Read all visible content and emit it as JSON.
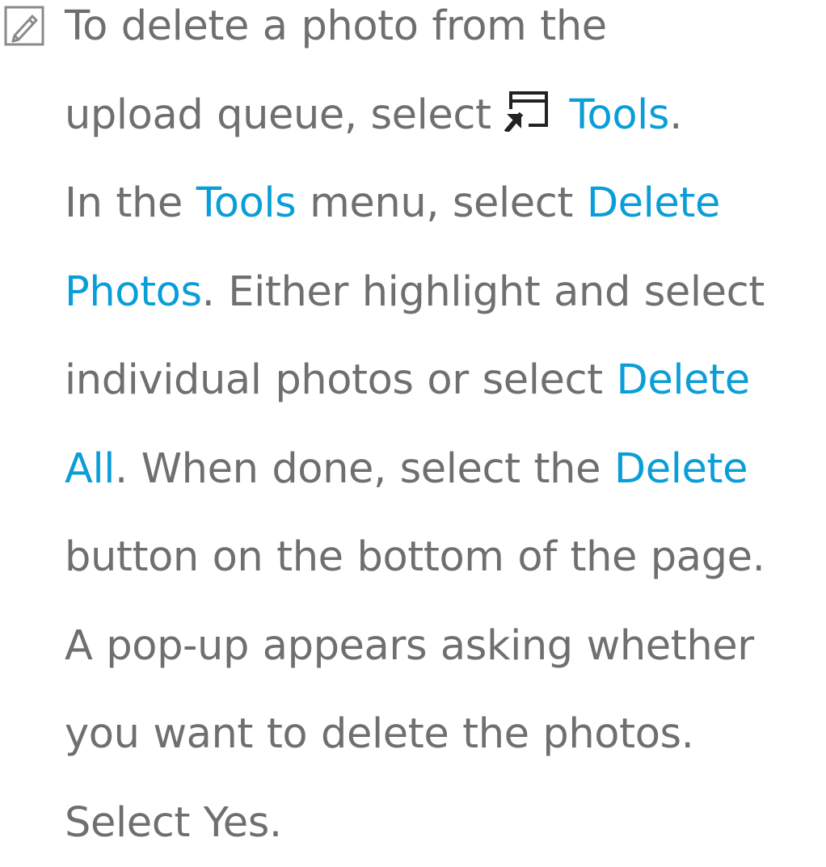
{
  "note": {
    "icon": "note-pencil-icon",
    "lines": {
      "l1": {
        "a": "To delete a photo from the"
      },
      "l2": {
        "a": "upload queue, select ",
        "icon": "tools-icon",
        "hl": "Tools",
        "b": "."
      },
      "l3": {
        "a": "In the ",
        "hl1": "Tools",
        "b": " menu, select ",
        "hl2": "Delete"
      },
      "l4": {
        "hl": "Photos",
        "a": ". Either highlight and select"
      },
      "l5": {
        "a": "individual photos or select ",
        "hl": "Delete"
      },
      "l6": {
        "hl1": "All",
        "a": ". When done, select the ",
        "hl2": "Delete"
      },
      "l7": {
        "a": "button on the bottom of the page."
      },
      "l8": {
        "a": "A pop-up appears asking whether"
      },
      "l9": {
        "a": "you want to delete the photos."
      },
      "l10": {
        "a": "Select Yes."
      }
    }
  },
  "colors": {
    "body_text": "#6f6f6f",
    "highlight": "#0a9ed8",
    "background": "#ffffff"
  }
}
